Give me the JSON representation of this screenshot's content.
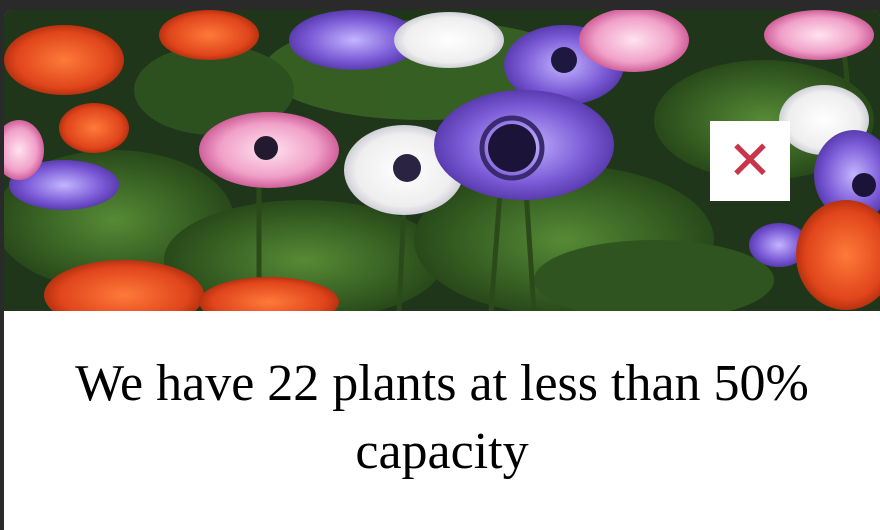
{
  "dialog": {
    "image_alt_icon": "flower-field-image",
    "close_button": {
      "label": "✕",
      "icon": "close-icon",
      "color": "#c8354a"
    },
    "message": "We have 22 plants at less than 50% capacity"
  },
  "colors": {
    "backdrop": "#2a2a2a",
    "card": "#ffffff",
    "close_accent": "#c8354a"
  }
}
